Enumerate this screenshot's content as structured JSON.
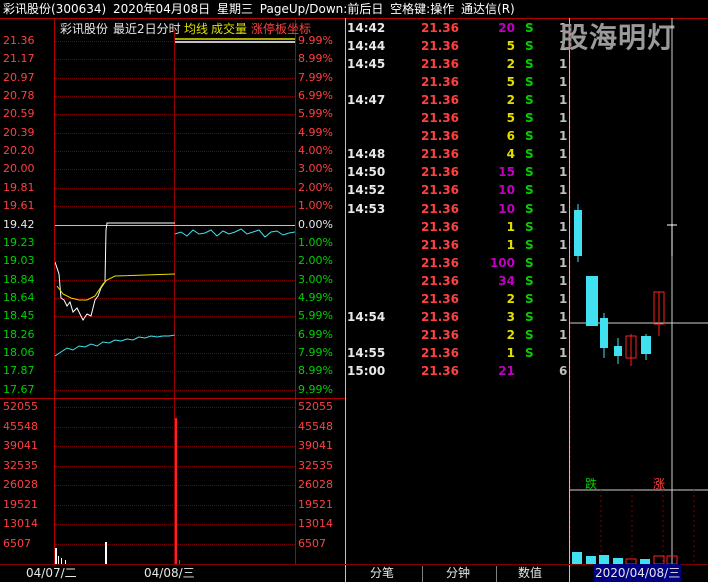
{
  "title_bar": {
    "stock": "彩讯股份(300634)",
    "date": "2020年04月08日",
    "weekday": "星期三",
    "hint": "PageUp/Down:前后日",
    "hint2": "空格键:操作",
    "app": "通达信(R)"
  },
  "chart_header": {
    "name": "彩讯股份",
    "period": "最近2日分时",
    "avg_line": "均线",
    "volume": "成交量",
    "limit": "涨停板坐标"
  },
  "price_ticks": [
    "21.36",
    "21.17",
    "20.97",
    "20.78",
    "20.59",
    "20.39",
    "20.20",
    "20.00",
    "19.81",
    "19.61",
    "19.42",
    "19.23",
    "19.03",
    "18.84",
    "18.64",
    "18.45",
    "18.26",
    "18.06",
    "17.87",
    "17.67"
  ],
  "pct_ticks": [
    "9.99%",
    "8.99%",
    "7.99%",
    "6.99%",
    "5.99%",
    "4.99%",
    "4.00%",
    "3.00%",
    "2.00%",
    "1.00%",
    "0.00%",
    "1.00%",
    "2.00%",
    "3.00%",
    "4.99%",
    "5.99%",
    "6.99%",
    "7.99%",
    "8.99%",
    "9.99%"
  ],
  "volume_ticks": [
    "52055",
    "45548",
    "39041",
    "32535",
    "26028",
    "19521",
    "13014",
    "6507"
  ],
  "x_labels": [
    "04/07/二",
    "04/08/三"
  ],
  "trades": [
    {
      "time": "14:42",
      "price": "21.36",
      "vol": "20",
      "color": "#c000c0",
      "side": "S",
      "n": "1"
    },
    {
      "time": "14:44",
      "price": "21.36",
      "vol": "5",
      "color": "#e0e000",
      "side": "S",
      "n": "1"
    },
    {
      "time": "14:45",
      "price": "21.36",
      "vol": "2",
      "color": "#e0e000",
      "side": "S",
      "n": "1"
    },
    {
      "time": "",
      "price": "21.36",
      "vol": "5",
      "color": "#e0e000",
      "side": "S",
      "n": "1"
    },
    {
      "time": "14:47",
      "price": "21.36",
      "vol": "2",
      "color": "#e0e000",
      "side": "S",
      "n": "1"
    },
    {
      "time": "",
      "price": "21.36",
      "vol": "5",
      "color": "#e0e000",
      "side": "S",
      "n": "1"
    },
    {
      "time": "",
      "price": "21.36",
      "vol": "6",
      "color": "#e0e000",
      "side": "S",
      "n": "1"
    },
    {
      "time": "14:48",
      "price": "21.36",
      "vol": "4",
      "color": "#e0e000",
      "side": "S",
      "n": "1"
    },
    {
      "time": "14:50",
      "price": "21.36",
      "vol": "15",
      "color": "#c000c0",
      "side": "S",
      "n": "1"
    },
    {
      "time": "14:52",
      "price": "21.36",
      "vol": "10",
      "color": "#c000c0",
      "side": "S",
      "n": "1"
    },
    {
      "time": "14:53",
      "price": "21.36",
      "vol": "10",
      "color": "#c000c0",
      "side": "S",
      "n": "1"
    },
    {
      "time": "",
      "price": "21.36",
      "vol": "1",
      "color": "#e0e000",
      "side": "S",
      "n": "1"
    },
    {
      "time": "",
      "price": "21.36",
      "vol": "1",
      "color": "#e0e000",
      "side": "S",
      "n": "1"
    },
    {
      "time": "",
      "price": "21.36",
      "vol": "100",
      "color": "#c000c0",
      "side": "S",
      "n": "1"
    },
    {
      "time": "",
      "price": "21.36",
      "vol": "34",
      "color": "#c000c0",
      "side": "S",
      "n": "1"
    },
    {
      "time": "",
      "price": "21.36",
      "vol": "2",
      "color": "#e0e000",
      "side": "S",
      "n": "1"
    },
    {
      "time": "14:54",
      "price": "21.36",
      "vol": "3",
      "color": "#e0e000",
      "side": "S",
      "n": "1"
    },
    {
      "time": "",
      "price": "21.36",
      "vol": "2",
      "color": "#e0e000",
      "side": "S",
      "n": "1"
    },
    {
      "time": "14:55",
      "price": "21.36",
      "vol": "1",
      "color": "#e0e000",
      "side": "S",
      "n": "1"
    },
    {
      "time": "15:00",
      "price": "21.36",
      "vol": "21",
      "color": "#c000c0",
      "side": "",
      "n": "6"
    }
  ],
  "tabs": [
    "分笔",
    "分钟",
    "数值"
  ],
  "watermark": "股海明灯",
  "kline": {
    "fall_label": "跌",
    "rise_label": "涨",
    "date": "2020/04/08/三"
  },
  "colors": {
    "up": "#ff4040",
    "down": "#00d000",
    "grid": "#b00000",
    "cyan": "#40e0f0"
  }
}
